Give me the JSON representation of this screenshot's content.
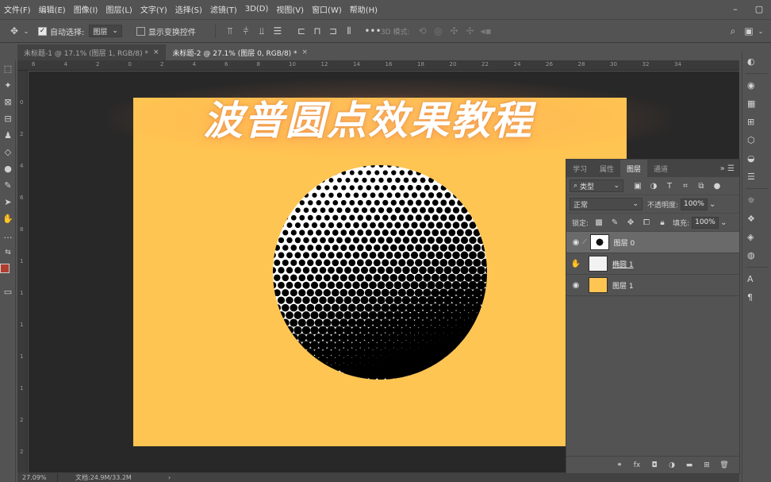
{
  "menu": [
    "文件(F)",
    "编辑(E)",
    "图像(I)",
    "图层(L)",
    "文字(Y)",
    "选择(S)",
    "滤镜(T)",
    "3D(D)",
    "视图(V)",
    "窗口(W)",
    "帮助(H)"
  ],
  "options": {
    "auto_select_label": "自动选择:",
    "auto_select_value": "图层",
    "show_transform_label": "显示变换控件",
    "three_d_mode_label": "3D 模式:"
  },
  "tabs": [
    {
      "label": "未标题-1 @ 17.1% (图层 1, RGB/8) *"
    },
    {
      "label": "未标题-2 @ 27.1% (图层 0, RGB/8) *"
    }
  ],
  "canvas": {
    "overlay_title": "波普圆点效果教程",
    "doc_color": "#ffc552"
  },
  "ruler_h": [
    "6",
    "4",
    "2",
    "0",
    "2",
    "4",
    "6",
    "8",
    "10",
    "12",
    "14",
    "16",
    "18",
    "20",
    "22",
    "24",
    "26",
    "28",
    "30",
    "32",
    "34"
  ],
  "ruler_v": [
    "0",
    "2",
    "4",
    "6",
    "8",
    "1",
    "1",
    "1",
    "1",
    "1",
    "2",
    "2"
  ],
  "layers_panel": {
    "tabs": [
      "学习",
      "属性",
      "图层",
      "通道"
    ],
    "filter_label": "类型",
    "blend_mode": "正常",
    "opacity_label": "不透明度:",
    "opacity_value": "100%",
    "lock_label": "锁定:",
    "fill_label": "填充:",
    "fill_value": "100%",
    "layers": [
      {
        "name": "图层 0",
        "selected": true
      },
      {
        "name": "椭圆 1",
        "selected": false
      },
      {
        "name": "图层 1",
        "selected": false
      }
    ]
  },
  "status": {
    "zoom": "27.09%",
    "doc_size": "文档:24.9M/33.2M"
  },
  "colors": {
    "foreground": "#b13d2f",
    "panel": "#535353",
    "canvas_bg": "#282828"
  }
}
